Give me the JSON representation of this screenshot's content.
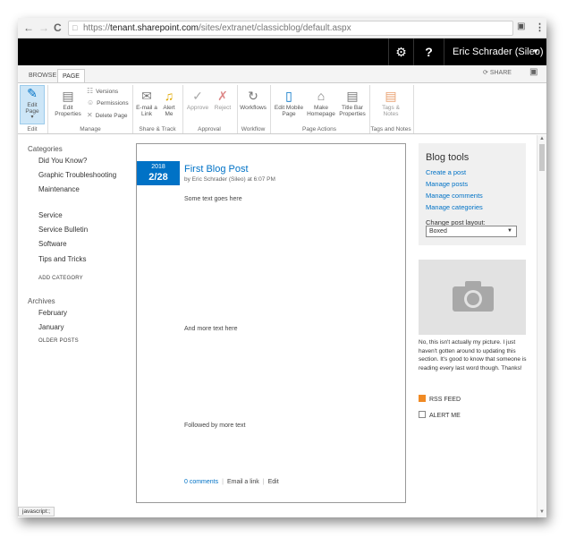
{
  "browser": {
    "back": "←",
    "forward": "→",
    "reload": "C",
    "url_scheme": "https://",
    "url_host": "tenant.sharepoint.com",
    "url_path": "/sites/extranet/classicblog/default.aspx",
    "translate_icon": "translate-icon",
    "menu_icon": "⋮"
  },
  "suite_bar": {
    "settings_icon": "⚙",
    "help_icon": "?",
    "user": "Eric Schrader (Sileo)",
    "caret": "▼"
  },
  "ribbon_tabs": [
    "BROWSE",
    "PAGE"
  ],
  "share_label": "SHARE",
  "ribbon": {
    "edit_page": "Edit Page",
    "edit_properties": "Edit Properties",
    "versions": "Versions",
    "permissions": "Permissions",
    "delete_page": "Delete Page",
    "email_link": "E-mail a Link",
    "alert_me": "Alert Me",
    "approve": "Approve",
    "reject": "Reject",
    "workflows": "Workflows",
    "edit_mobile": "Edit Mobile Page",
    "make_homepage": "Make Homepage",
    "title_bar_props": "Title Bar Properties",
    "tags_notes": "Tags & Notes",
    "groups": {
      "edit": "Edit",
      "manage": "Manage",
      "share_track": "Share & Track",
      "approval": "Approval",
      "workflow": "Workflow",
      "page_actions": "Page Actions",
      "tags_notes": "Tags and Notes"
    }
  },
  "left_nav": {
    "categories_heading": "Categories",
    "categories": [
      "Did You Know?",
      "Graphic Troubleshooting",
      "Maintenance",
      "Service",
      "Service Bulletin",
      "Software",
      "Tips and Tricks"
    ],
    "add_category": "ADD CATEGORY",
    "archives_heading": "Archives",
    "archives": [
      "February",
      "January"
    ],
    "older_posts": "OLDER POSTS"
  },
  "post": {
    "year": "2018",
    "date": "2/28",
    "title": "First Blog Post",
    "byline": "by Eric Schrader (Sileo) at 6:07 PM",
    "paragraphs": [
      "Some text goes here",
      "And more text here",
      "Followed by more text"
    ],
    "comments": "0 comments",
    "email_link": "Email a link",
    "edit": "Edit"
  },
  "blog_tools": {
    "title": "Blog tools",
    "links": [
      "Create a post",
      "Manage posts",
      "Manage comments",
      "Manage categories"
    ],
    "layout_label": "Change post layout:",
    "layout_value": "Boxed"
  },
  "about": {
    "text": "No, this isn't actually my picture. I just haven't gotten around to updating this section. It's good to know that someone is reading every last word though. Thanks!",
    "rss": "RSS FEED",
    "alert": "ALERT ME"
  },
  "status_bar": "javascript:;",
  "colors": {
    "accent": "#0072c6",
    "suite_bar": "#000000",
    "rss": "#f08a24"
  }
}
